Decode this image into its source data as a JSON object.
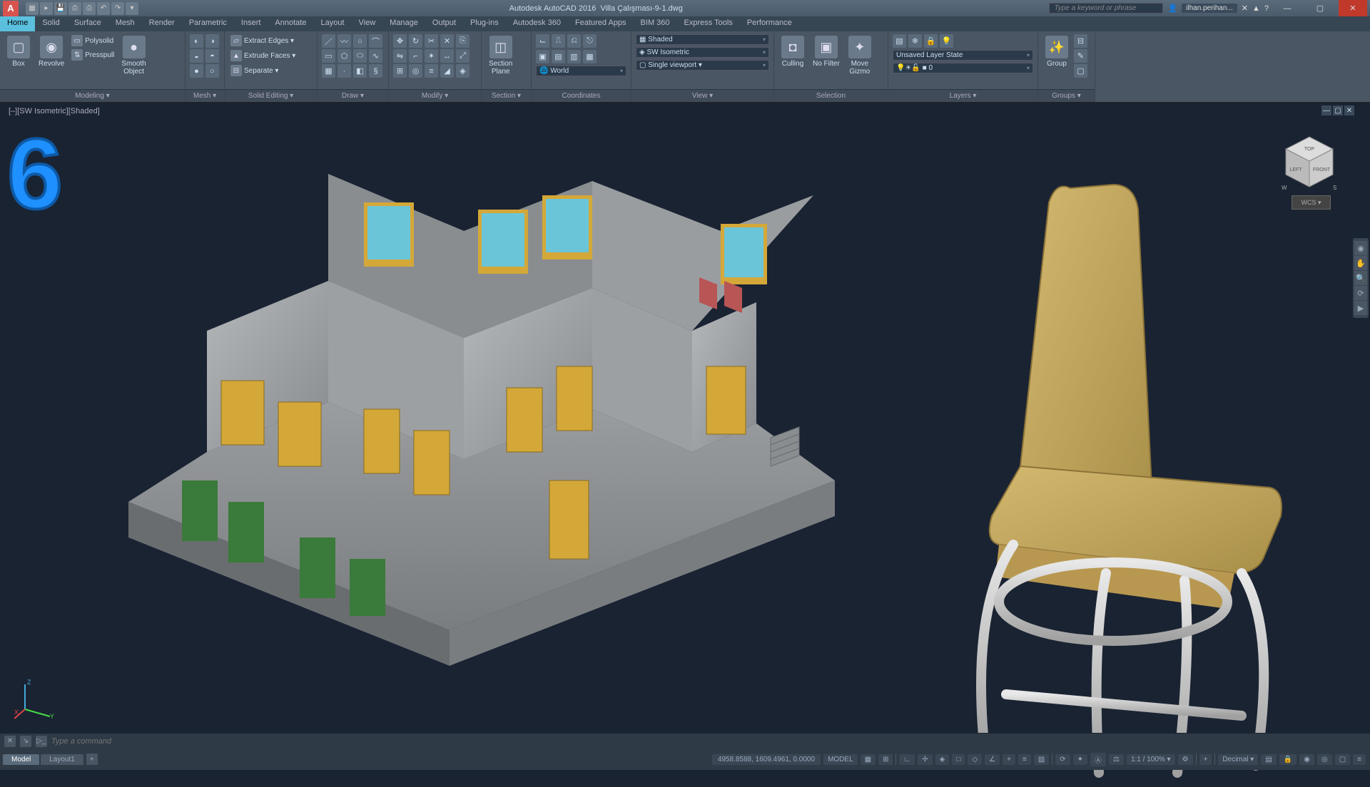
{
  "app": {
    "title": "Autodesk AutoCAD 2016",
    "document": "Villa Çalışması-9-1.dwg"
  },
  "search": {
    "placeholder": "Type a keyword or phrase"
  },
  "user": {
    "name": "ilhan.perihan..."
  },
  "tabs": [
    "Home",
    "Solid",
    "Surface",
    "Mesh",
    "Render",
    "Parametric",
    "Insert",
    "Annotate",
    "Layout",
    "View",
    "Manage",
    "Output",
    "Plug-ins",
    "Autodesk 360",
    "Featured Apps",
    "BIM 360",
    "Express Tools",
    "Performance"
  ],
  "active_tab": "Home",
  "ribbon": {
    "modeling": {
      "title": "Modeling ▾",
      "box": "Box",
      "revolve": "Revolve",
      "polysolid": "Polysolid",
      "presspull": "Presspull",
      "smooth": "Smooth\nObject",
      "mesh": "Mesh ▾"
    },
    "solid_editing": {
      "title": "Solid Editing ▾",
      "extract": "Extract Edges ▾",
      "extrude": "Extrude Faces ▾",
      "separate": "Separate ▾"
    },
    "draw": {
      "title": "Draw ▾"
    },
    "modify": {
      "title": "Modify ▾"
    },
    "section": {
      "title": "Section ▾",
      "plane": "Section\nPlane"
    },
    "coordinates": {
      "title": "Coordinates",
      "world": "World"
    },
    "view": {
      "title": "View ▾",
      "shaded": "Shaded",
      "iso": "SW Isometric",
      "single": "Single viewport ▾"
    },
    "selection": {
      "title": "Selection",
      "culling": "Culling",
      "nofilter": "No Filter",
      "gizmo": "Move\nGizmo"
    },
    "layers": {
      "title": "Layers ▾",
      "state": "Unsaved Layer State",
      "current": "0"
    },
    "groups": {
      "title": "Groups ▾",
      "group": "Group"
    }
  },
  "viewport": {
    "label": "[–][SW Isometric][Shaded]",
    "wcs": "WCS ▾",
    "cube": {
      "top": "TOP",
      "left": "LEFT",
      "front": "FRONT",
      "w": "W",
      "s": "S"
    }
  },
  "command": {
    "placeholder": "Type a command"
  },
  "filetabs": {
    "model": "Model",
    "layout1": "Layout1"
  },
  "status": {
    "coords": "4958.8588, 1609.4961, 0.0000",
    "space": "MODEL",
    "scale": "1:1 / 100% ▾",
    "units": "Decimal ▾"
  }
}
